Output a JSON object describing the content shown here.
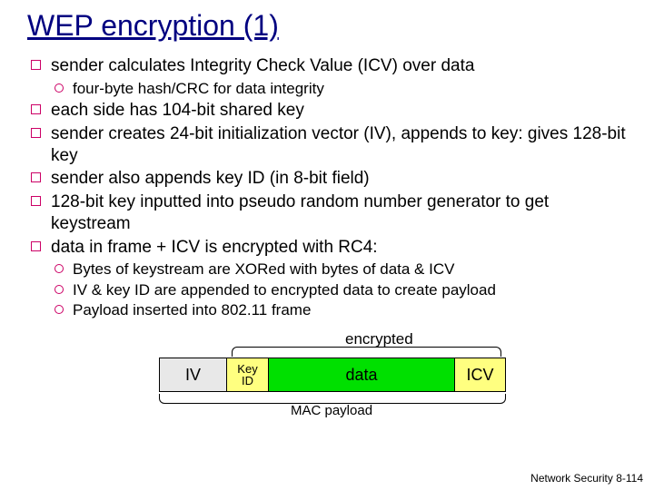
{
  "title": "WEP encryption (1)",
  "bullets": {
    "b1": "sender calculates Integrity Check Value (ICV) over data",
    "b1s1": "four-byte hash/CRC for data integrity",
    "b2": "each side has 104-bit shared key",
    "b3": "sender creates 24-bit initialization vector (IV), appends to key: gives 128-bit key",
    "b4": "sender also appends key ID (in 8-bit field)",
    "b5": "128-bit key inputted into pseudo random number generator to get keystream",
    "b6": "data in frame + ICV is encrypted with RC4:",
    "b6s1": "Bytes of keystream are XORed with bytes of data & ICV",
    "b6s2": "IV & key ID are appended to encrypted data to create payload",
    "b6s3": "Payload inserted into 802.11 frame"
  },
  "diagram": {
    "encrypted": "encrypted",
    "iv": "IV",
    "keyid_l1": "Key",
    "keyid_l2": "ID",
    "data": "data",
    "icv": "ICV",
    "mac": "MAC payload"
  },
  "footer": "Network Security  8-114"
}
